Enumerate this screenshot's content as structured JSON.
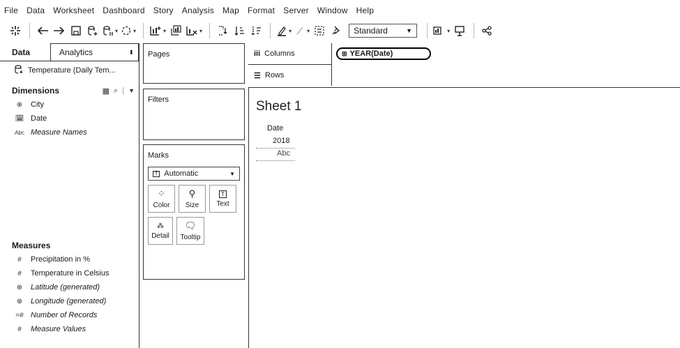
{
  "menu": [
    "File",
    "Data",
    "Worksheet",
    "Dashboard",
    "Story",
    "Analysis",
    "Map",
    "Format",
    "Server",
    "Window",
    "Help"
  ],
  "toolbar": {
    "fit_label": "Standard",
    "fit_options": [
      "Standard"
    ]
  },
  "left_pane": {
    "tab_data": "Data",
    "tab_analytics": "Analytics",
    "datasource": "Temperature (Daily Tem...",
    "dimensions_title": "Dimensions",
    "dimensions": [
      {
        "icon": "globe-icon",
        "label": "City",
        "italic": false
      },
      {
        "icon": "calendar-icon",
        "label": "Date",
        "italic": false
      },
      {
        "icon": "abc-icon",
        "label": "Measure Names",
        "italic": true
      }
    ],
    "measures_title": "Measures",
    "measures": [
      {
        "icon": "hash-icon",
        "label": "Precipitation in %",
        "italic": false
      },
      {
        "icon": "hash-icon",
        "label": "Temperature in Celsius",
        "italic": false
      },
      {
        "icon": "globe-icon",
        "label": "Latitude (generated)",
        "italic": true
      },
      {
        "icon": "globe-icon",
        "label": "Longitude (generated)",
        "italic": true
      },
      {
        "icon": "hash-icon",
        "label": "Number of Records",
        "italic": true
      },
      {
        "icon": "hash-icon",
        "label": "Measure Values",
        "italic": true
      }
    ]
  },
  "cards": {
    "pages": "Pages",
    "filters": "Filters",
    "marks": "Marks",
    "marks_type": "Automatic",
    "mark_buttons": [
      "Color",
      "Size",
      "Text",
      "Detail",
      "Tooltip"
    ]
  },
  "shelves": {
    "columns": "Columns",
    "rows": "Rows",
    "column_pill": "YEAR(Date)"
  },
  "sheet": {
    "title": "Sheet 1",
    "header": "Date",
    "year": "2018",
    "cell": "Abc"
  }
}
